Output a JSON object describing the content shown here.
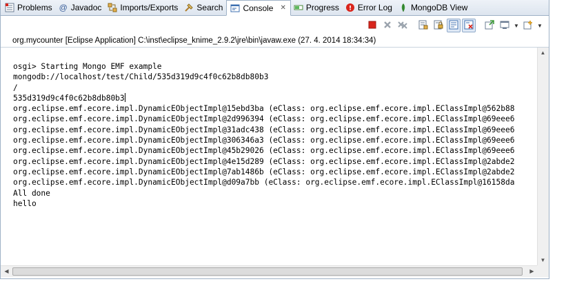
{
  "tabs": [
    {
      "label": "Problems",
      "icon": "problems-icon"
    },
    {
      "label": "Javadoc",
      "icon": "javadoc-icon"
    },
    {
      "label": "Imports/Exports",
      "icon": "imports-exports-icon"
    },
    {
      "label": "Search",
      "icon": "search-icon"
    },
    {
      "label": "Console",
      "icon": "console-icon",
      "active": true
    },
    {
      "label": "Progress",
      "icon": "progress-icon"
    },
    {
      "label": "Error Log",
      "icon": "error-log-icon"
    },
    {
      "label": "MongoDB View",
      "icon": "mongodb-leaf-icon"
    }
  ],
  "tab_glyphs": {
    "javadoc": "@"
  },
  "process_line": "org.mycounter [Eclipse Application] C:\\inst\\eclipse_knime_2.9.2\\jre\\bin\\javaw.exe (27. 4. 2014 18:34:34)",
  "console_lines": [
    "osgi> Starting Mongo EMF example",
    "mongodb://localhost/test/Child/535d319d9c4f0c62b8db80b3",
    "/",
    "535d319d9c4f0c62b8db80b3",
    "org.eclipse.emf.ecore.impl.DynamicEObjectImpl@15ebd3ba (eClass: org.eclipse.emf.ecore.impl.EClassImpl@562b88",
    "org.eclipse.emf.ecore.impl.DynamicEObjectImpl@2d996394 (eClass: org.eclipse.emf.ecore.impl.EClassImpl@69eee6",
    "org.eclipse.emf.ecore.impl.DynamicEObjectImpl@31adc438 (eClass: org.eclipse.emf.ecore.impl.EClassImpl@69eee6",
    "org.eclipse.emf.ecore.impl.DynamicEObjectImpl@306346a3 (eClass: org.eclipse.emf.ecore.impl.EClassImpl@69eee6",
    "org.eclipse.emf.ecore.impl.DynamicEObjectImpl@45b29026 (eClass: org.eclipse.emf.ecore.impl.EClassImpl@69eee6",
    "org.eclipse.emf.ecore.impl.DynamicEObjectImpl@4e15d289 (eClass: org.eclipse.emf.ecore.impl.EClassImpl@2abde2",
    "org.eclipse.emf.ecore.impl.DynamicEObjectImpl@7ab1486b (eClass: org.eclipse.emf.ecore.impl.EClassImpl@2abde2",
    "org.eclipse.emf.ecore.impl.DynamicEObjectImpl@d09a7bb (eClass: org.eclipse.emf.ecore.impl.EClassImpl@16158da",
    "All done",
    "hello"
  ],
  "toolbar_icons": [
    "terminate-icon",
    "remove-launch-icon",
    "remove-all-terminated-icon",
    "clear-console-icon",
    "scroll-lock-icon",
    "word-wrap-icon",
    "show-console-on-output-icon",
    "show-console-on-error-icon",
    "pin-console-icon",
    "display-selected-console-icon",
    "open-console-icon"
  ],
  "colors": {
    "terminate": "#d9251c",
    "accent": "#3c6fb0",
    "tab_bg": "#dde5ef",
    "border": "#9eb1c6"
  }
}
